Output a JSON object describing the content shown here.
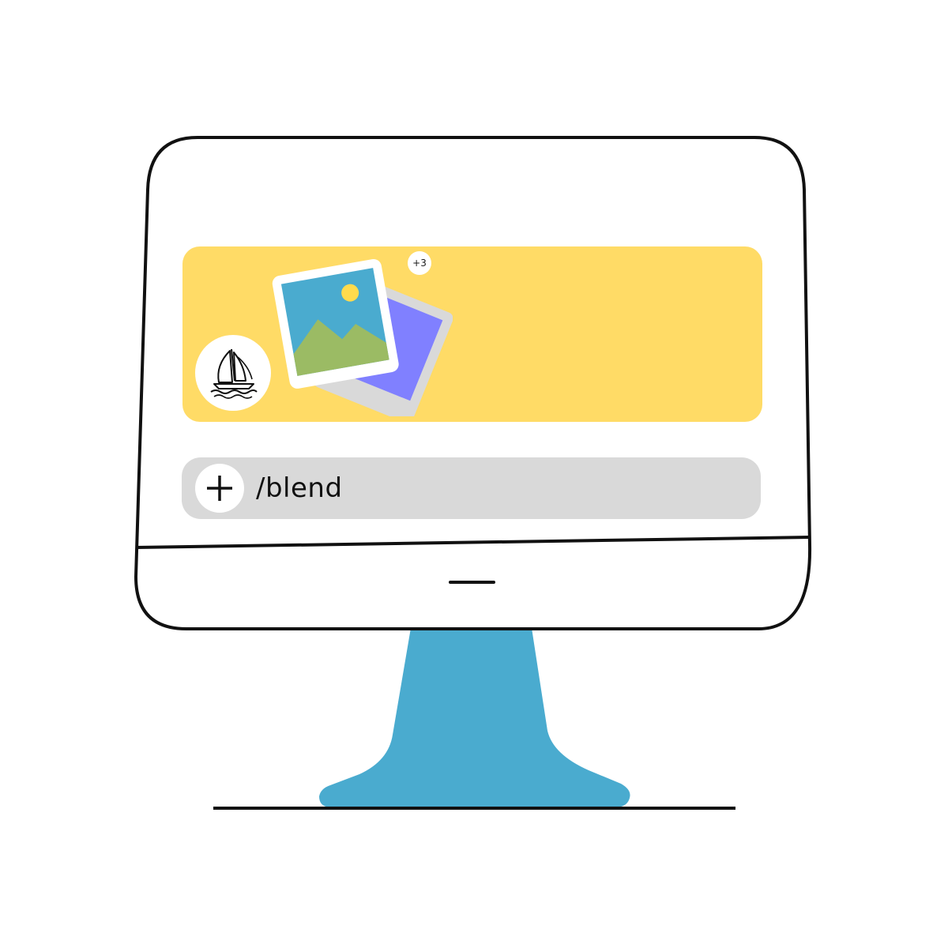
{
  "colors": {
    "message_panel": "#ffdb66",
    "input_bar": "#d9d9d9",
    "monitor_stand": "#4aabcf",
    "outline": "#111111",
    "image_sky": "#4aabcf",
    "image_hills": "#9bbb64",
    "image_sun": "#ffdb4d",
    "back_image": "#8080ff",
    "frame_back": "#d9d9d9"
  },
  "message": {
    "bot_icon": "sailboat-icon",
    "image_icon": "image-stack-icon",
    "extra_images_badge": "+3"
  },
  "composer": {
    "add_icon": "plus-icon",
    "command": "/blend"
  },
  "monitor": {
    "power_indicator_icon": "dash-icon"
  }
}
